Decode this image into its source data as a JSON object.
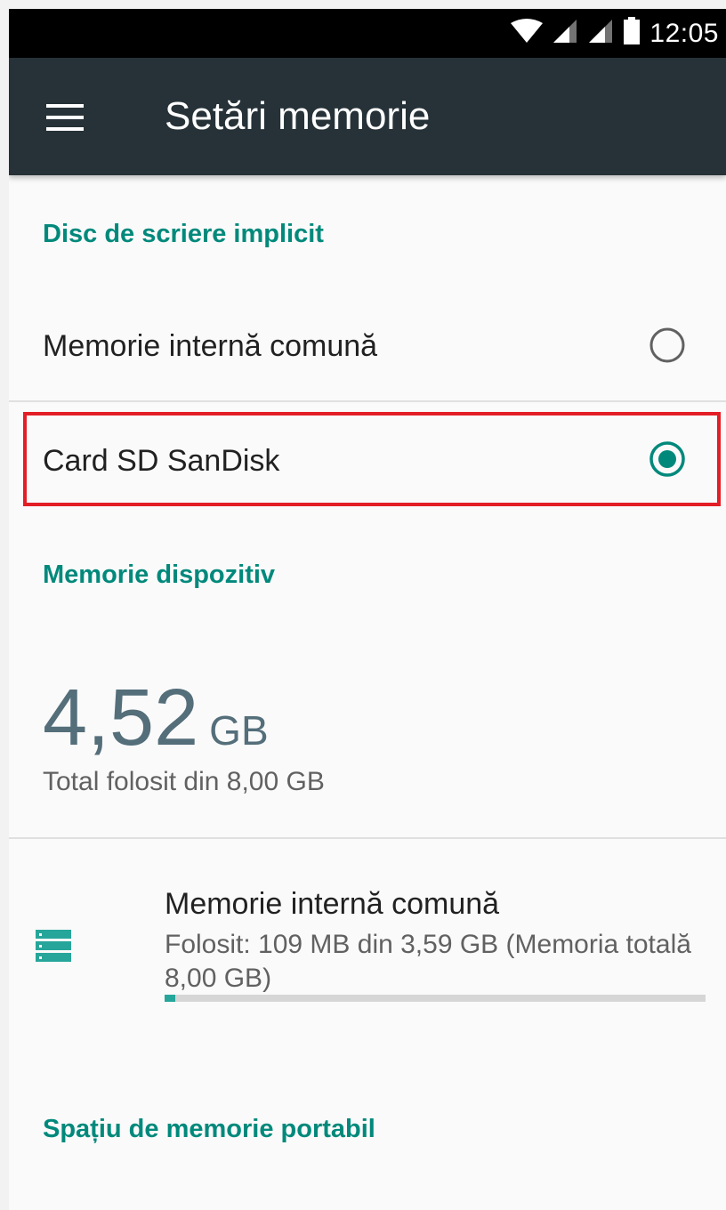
{
  "status_bar": {
    "time": "12:05",
    "icons": [
      "wifi-icon",
      "signal-icon",
      "signal-icon",
      "battery-icon"
    ]
  },
  "app_bar": {
    "menu_icon": "menu-icon",
    "title": "Setări memorie"
  },
  "default_write_disk": {
    "header": "Disc de scriere implicit",
    "options": [
      {
        "label": "Memorie internă comună",
        "selected": false
      },
      {
        "label": "Card SD SanDisk",
        "selected": true
      }
    ]
  },
  "device_storage": {
    "header": "Memorie dispozitiv",
    "used_value": "4,52",
    "used_unit": "GB",
    "used_subtitle": "Total folosit din 8,00 GB",
    "volumes": [
      {
        "icon": "storage-icon",
        "title": "Memorie internă comună",
        "summary": "Folosit: 109 MB din 3,59 GB (Memoria totală 8,00 GB)",
        "used_fraction": 0.02
      }
    ]
  },
  "portable_storage": {
    "header": "Spațiu de memorie portabil"
  },
  "colors": {
    "accent": "#00897b",
    "app_bar": "#263238",
    "highlight": "#e41e26",
    "progress": "#26a69a"
  }
}
